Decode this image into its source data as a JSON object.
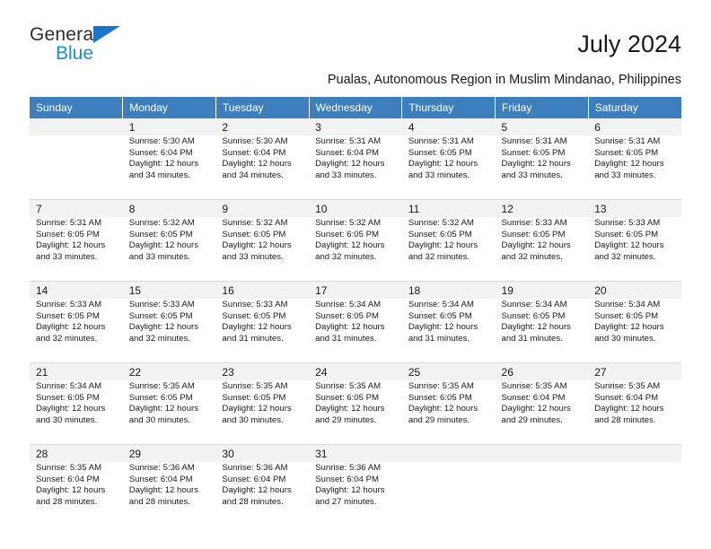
{
  "brand": {
    "name_part1": "General",
    "name_part2": "Blue",
    "accent_color": "#1a8ad4",
    "triangle_color": "#1a76c8"
  },
  "header": {
    "month_title": "July 2024",
    "location": "Pualas, Autonomous Region in Muslim Mindanao, Philippines"
  },
  "calendar": {
    "header_bg": "#3d7ebd",
    "weekday_headers": [
      "Sunday",
      "Monday",
      "Tuesday",
      "Wednesday",
      "Thursday",
      "Friday",
      "Saturday"
    ],
    "weeks": [
      [
        {
          "day": "",
          "sunrise": "",
          "sunset": "",
          "daylight1": "",
          "daylight2": ""
        },
        {
          "day": "1",
          "sunrise": "Sunrise: 5:30 AM",
          "sunset": "Sunset: 6:04 PM",
          "daylight1": "Daylight: 12 hours",
          "daylight2": "and 34 minutes."
        },
        {
          "day": "2",
          "sunrise": "Sunrise: 5:30 AM",
          "sunset": "Sunset: 6:04 PM",
          "daylight1": "Daylight: 12 hours",
          "daylight2": "and 34 minutes."
        },
        {
          "day": "3",
          "sunrise": "Sunrise: 5:31 AM",
          "sunset": "Sunset: 6:04 PM",
          "daylight1": "Daylight: 12 hours",
          "daylight2": "and 33 minutes."
        },
        {
          "day": "4",
          "sunrise": "Sunrise: 5:31 AM",
          "sunset": "Sunset: 6:05 PM",
          "daylight1": "Daylight: 12 hours",
          "daylight2": "and 33 minutes."
        },
        {
          "day": "5",
          "sunrise": "Sunrise: 5:31 AM",
          "sunset": "Sunset: 6:05 PM",
          "daylight1": "Daylight: 12 hours",
          "daylight2": "and 33 minutes."
        },
        {
          "day": "6",
          "sunrise": "Sunrise: 5:31 AM",
          "sunset": "Sunset: 6:05 PM",
          "daylight1": "Daylight: 12 hours",
          "daylight2": "and 33 minutes."
        }
      ],
      [
        {
          "day": "7",
          "sunrise": "Sunrise: 5:31 AM",
          "sunset": "Sunset: 6:05 PM",
          "daylight1": "Daylight: 12 hours",
          "daylight2": "and 33 minutes."
        },
        {
          "day": "8",
          "sunrise": "Sunrise: 5:32 AM",
          "sunset": "Sunset: 6:05 PM",
          "daylight1": "Daylight: 12 hours",
          "daylight2": "and 33 minutes."
        },
        {
          "day": "9",
          "sunrise": "Sunrise: 5:32 AM",
          "sunset": "Sunset: 6:05 PM",
          "daylight1": "Daylight: 12 hours",
          "daylight2": "and 33 minutes."
        },
        {
          "day": "10",
          "sunrise": "Sunrise: 5:32 AM",
          "sunset": "Sunset: 6:05 PM",
          "daylight1": "Daylight: 12 hours",
          "daylight2": "and 32 minutes."
        },
        {
          "day": "11",
          "sunrise": "Sunrise: 5:32 AM",
          "sunset": "Sunset: 6:05 PM",
          "daylight1": "Daylight: 12 hours",
          "daylight2": "and 32 minutes."
        },
        {
          "day": "12",
          "sunrise": "Sunrise: 5:33 AM",
          "sunset": "Sunset: 6:05 PM",
          "daylight1": "Daylight: 12 hours",
          "daylight2": "and 32 minutes."
        },
        {
          "day": "13",
          "sunrise": "Sunrise: 5:33 AM",
          "sunset": "Sunset: 6:05 PM",
          "daylight1": "Daylight: 12 hours",
          "daylight2": "and 32 minutes."
        }
      ],
      [
        {
          "day": "14",
          "sunrise": "Sunrise: 5:33 AM",
          "sunset": "Sunset: 6:05 PM",
          "daylight1": "Daylight: 12 hours",
          "daylight2": "and 32 minutes."
        },
        {
          "day": "15",
          "sunrise": "Sunrise: 5:33 AM",
          "sunset": "Sunset: 6:05 PM",
          "daylight1": "Daylight: 12 hours",
          "daylight2": "and 32 minutes."
        },
        {
          "day": "16",
          "sunrise": "Sunrise: 5:33 AM",
          "sunset": "Sunset: 6:05 PM",
          "daylight1": "Daylight: 12 hours",
          "daylight2": "and 31 minutes."
        },
        {
          "day": "17",
          "sunrise": "Sunrise: 5:34 AM",
          "sunset": "Sunset: 6:05 PM",
          "daylight1": "Daylight: 12 hours",
          "daylight2": "and 31 minutes."
        },
        {
          "day": "18",
          "sunrise": "Sunrise: 5:34 AM",
          "sunset": "Sunset: 6:05 PM",
          "daylight1": "Daylight: 12 hours",
          "daylight2": "and 31 minutes."
        },
        {
          "day": "19",
          "sunrise": "Sunrise: 5:34 AM",
          "sunset": "Sunset: 6:05 PM",
          "daylight1": "Daylight: 12 hours",
          "daylight2": "and 31 minutes."
        },
        {
          "day": "20",
          "sunrise": "Sunrise: 5:34 AM",
          "sunset": "Sunset: 6:05 PM",
          "daylight1": "Daylight: 12 hours",
          "daylight2": "and 30 minutes."
        }
      ],
      [
        {
          "day": "21",
          "sunrise": "Sunrise: 5:34 AM",
          "sunset": "Sunset: 6:05 PM",
          "daylight1": "Daylight: 12 hours",
          "daylight2": "and 30 minutes."
        },
        {
          "day": "22",
          "sunrise": "Sunrise: 5:35 AM",
          "sunset": "Sunset: 6:05 PM",
          "daylight1": "Daylight: 12 hours",
          "daylight2": "and 30 minutes."
        },
        {
          "day": "23",
          "sunrise": "Sunrise: 5:35 AM",
          "sunset": "Sunset: 6:05 PM",
          "daylight1": "Daylight: 12 hours",
          "daylight2": "and 30 minutes."
        },
        {
          "day": "24",
          "sunrise": "Sunrise: 5:35 AM",
          "sunset": "Sunset: 6:05 PM",
          "daylight1": "Daylight: 12 hours",
          "daylight2": "and 29 minutes."
        },
        {
          "day": "25",
          "sunrise": "Sunrise: 5:35 AM",
          "sunset": "Sunset: 6:05 PM",
          "daylight1": "Daylight: 12 hours",
          "daylight2": "and 29 minutes."
        },
        {
          "day": "26",
          "sunrise": "Sunrise: 5:35 AM",
          "sunset": "Sunset: 6:04 PM",
          "daylight1": "Daylight: 12 hours",
          "daylight2": "and 29 minutes."
        },
        {
          "day": "27",
          "sunrise": "Sunrise: 5:35 AM",
          "sunset": "Sunset: 6:04 PM",
          "daylight1": "Daylight: 12 hours",
          "daylight2": "and 28 minutes."
        }
      ],
      [
        {
          "day": "28",
          "sunrise": "Sunrise: 5:35 AM",
          "sunset": "Sunset: 6:04 PM",
          "daylight1": "Daylight: 12 hours",
          "daylight2": "and 28 minutes."
        },
        {
          "day": "29",
          "sunrise": "Sunrise: 5:36 AM",
          "sunset": "Sunset: 6:04 PM",
          "daylight1": "Daylight: 12 hours",
          "daylight2": "and 28 minutes."
        },
        {
          "day": "30",
          "sunrise": "Sunrise: 5:36 AM",
          "sunset": "Sunset: 6:04 PM",
          "daylight1": "Daylight: 12 hours",
          "daylight2": "and 28 minutes."
        },
        {
          "day": "31",
          "sunrise": "Sunrise: 5:36 AM",
          "sunset": "Sunset: 6:04 PM",
          "daylight1": "Daylight: 12 hours",
          "daylight2": "and 27 minutes."
        },
        {
          "day": "",
          "sunrise": "",
          "sunset": "",
          "daylight1": "",
          "daylight2": ""
        },
        {
          "day": "",
          "sunrise": "",
          "sunset": "",
          "daylight1": "",
          "daylight2": ""
        },
        {
          "day": "",
          "sunrise": "",
          "sunset": "",
          "daylight1": "",
          "daylight2": ""
        }
      ]
    ]
  }
}
